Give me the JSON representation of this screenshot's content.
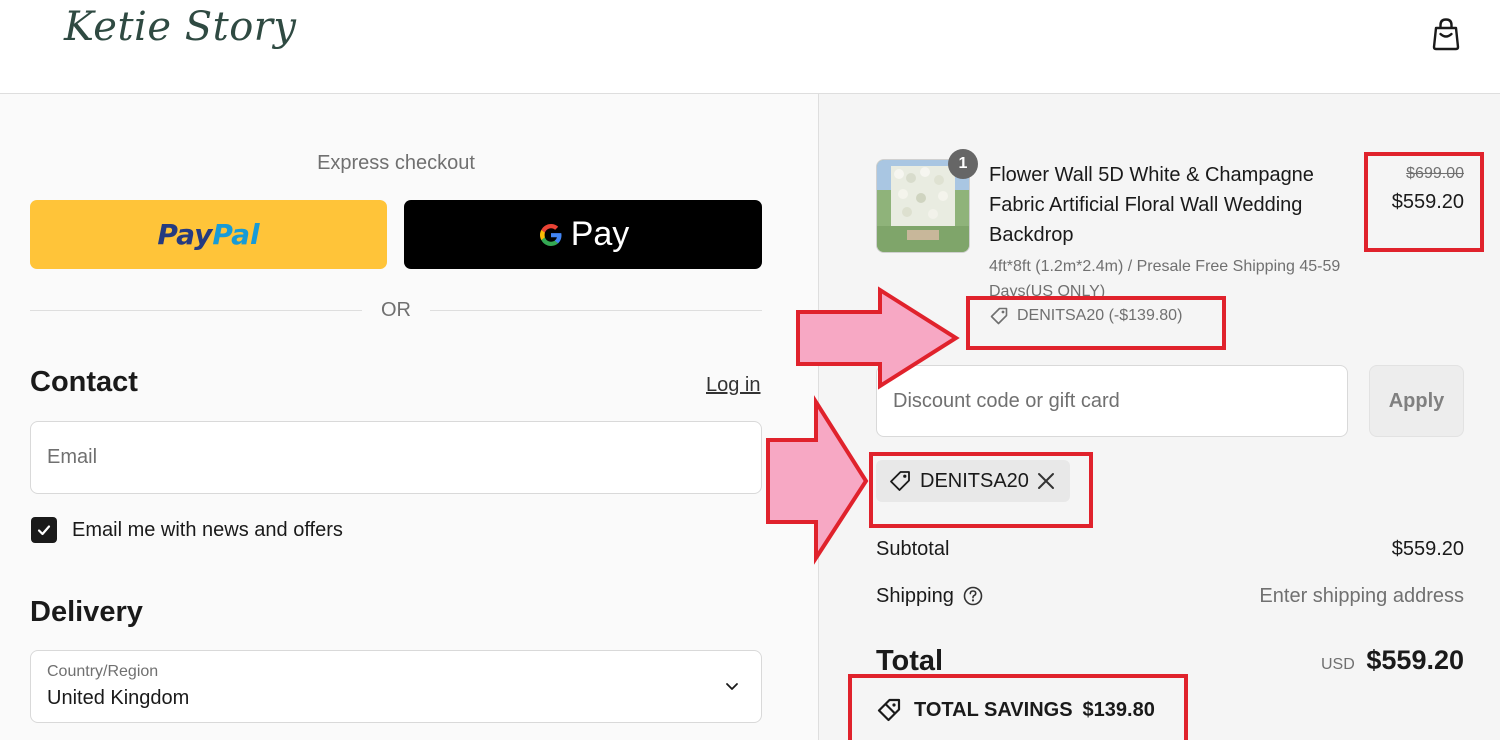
{
  "header": {
    "logo_text": "Ketie Story",
    "cart_icon": "shopping-bag-icon"
  },
  "express": {
    "title": "Express checkout",
    "paypal_label_1": "Pay",
    "paypal_label_2": "Pal",
    "gpay_label": "Pay",
    "or_text": "OR"
  },
  "contact": {
    "heading": "Contact",
    "login_label": "Log in",
    "email_placeholder": "Email",
    "news_checkbox_label": "Email me with news and offers",
    "news_checked": true
  },
  "delivery": {
    "heading": "Delivery",
    "country_label": "Country/Region",
    "country_value": "United Kingdom"
  },
  "order": {
    "item": {
      "quantity": "1",
      "title": "Flower Wall 5D White & Champagne Fabric Artificial Floral Wall Wedding Backdrop",
      "variant": "4ft*8ft  (1.2m*2.4m) / Presale Free Shipping 45-59 Days(US ONLY)",
      "discount_line": "DENITSA20 (-$139.80)",
      "price_original": "$699.00",
      "price_current": "$559.20"
    },
    "discount_placeholder": "Discount code or gift card",
    "apply_label": "Apply",
    "applied_code": "DENITSA20",
    "subtotal_label": "Subtotal",
    "subtotal_value": "$559.20",
    "shipping_label": "Shipping",
    "shipping_value": "Enter shipping address",
    "total_label": "Total",
    "total_currency": "USD",
    "total_value": "$559.20",
    "savings_label": "TOTAL SAVINGS",
    "savings_value": "$139.80"
  },
  "annotation_colors": {
    "box": "#e0222c",
    "arrow_fill": "#f7a8c4"
  }
}
